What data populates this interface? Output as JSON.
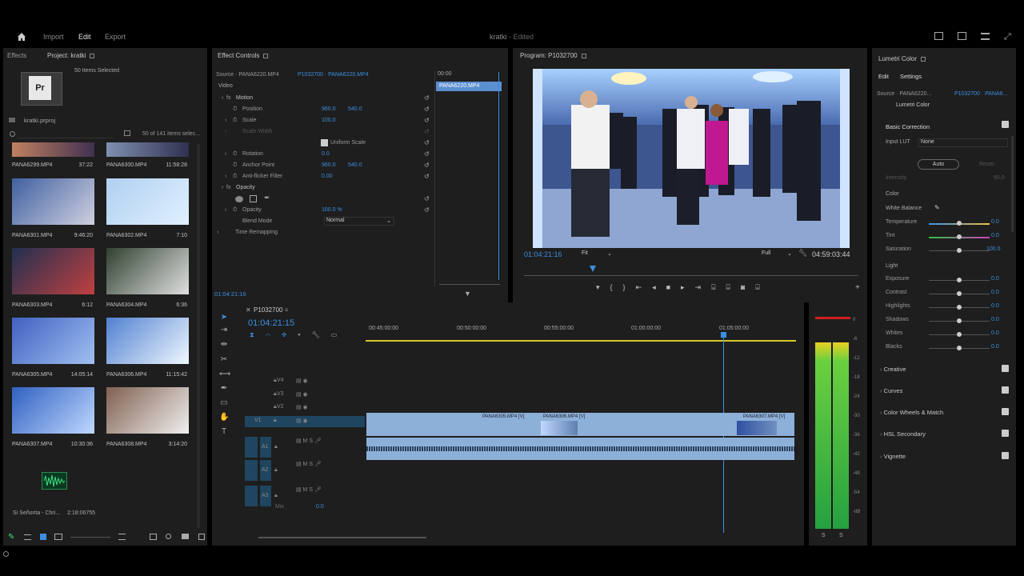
{
  "topbar": {
    "nav": [
      "Import",
      "Edit",
      "Export"
    ],
    "active": "Edit",
    "title": "kratki",
    "edited": "- Edited"
  },
  "project": {
    "tabs": [
      "Effects",
      "Project: kratki"
    ],
    "selected_count": "50 Items Selected",
    "file": "kratki.prproj",
    "items_info": "50 of 141 items selec...",
    "top_clips": [
      {
        "name": "PANA6299.MP4",
        "dur": "37:22"
      },
      {
        "name": "PANA6300.MP4",
        "dur": "11:58:28"
      }
    ],
    "clips": [
      {
        "name": "PANA6301.MP4",
        "dur": "9:46:20"
      },
      {
        "name": "PANA6302.MP4",
        "dur": "7:10"
      },
      {
        "name": "PANA6303.MP4",
        "dur": "6:12"
      },
      {
        "name": "PANA6304.MP4",
        "dur": "6:36"
      },
      {
        "name": "PANA6305.MP4",
        "dur": "14:05:14"
      },
      {
        "name": "PANA6306.MP4",
        "dur": "11:15:42"
      },
      {
        "name": "PANA6307.MP4",
        "dur": "10:30:36"
      },
      {
        "name": "PANA6308.MP4",
        "dur": "3:14:20"
      }
    ],
    "audio_name": "Si Señorita - Chri...",
    "audio_dur": "2:18:06755"
  },
  "effect_controls": {
    "title": "Effect Controls",
    "source": "Source · PANA6220.MP4",
    "sequence": "P1032700 · PANA6220.MP4",
    "time": "00:00",
    "clip": "PANA6220.MP4",
    "video": "Video",
    "motion": "Motion",
    "position": "Position",
    "pos_x": "960.0",
    "pos_y": "540.0",
    "scale": "Scale",
    "scale_v": "100.0",
    "scale_width": "Scale Width",
    "uniform": "Uniform Scale",
    "rotation": "Rotation",
    "rot_v": "0.0",
    "anchor": "Anchor Point",
    "anc_x": "960.0",
    "anc_y": "540.0",
    "flicker": "Anti-flicker Filter",
    "flick_v": "0.00",
    "opacity_grp": "Opacity",
    "opacity": "Opacity",
    "opacity_v": "100.0 %",
    "blend": "Blend Mode",
    "blend_v": "Normal",
    "remap": "Time Remapping",
    "timecode": "01:04:21:16"
  },
  "program": {
    "title": "Program: P1032700",
    "tc": "01:04:21:16",
    "fit": "Fit",
    "full": "Full",
    "duration": "04:59:03:44"
  },
  "timeline": {
    "seq": "P1032700",
    "tc": "01:04:21:15",
    "ruler": [
      "00:45:00:00",
      "00:50:00:00",
      "00:55:00:00",
      "01:00:00:00",
      "01:05:00:00"
    ],
    "video_tracks": [
      "V4",
      "V3",
      "V2",
      "V1"
    ],
    "audio_tracks": [
      "A1",
      "A2",
      "A3"
    ],
    "mix": "Mix",
    "mix_v": "0.0",
    "clips": [
      "PANA6305.MP4 [V]",
      "PANA6306.MP4 [V]",
      "PANA6307.MP4 [V]"
    ]
  },
  "meter": {
    "labels": [
      "0",
      "-6",
      "-12",
      "-18",
      "-24",
      "-30",
      "-36",
      "-42",
      "-48",
      "-54",
      "-dB"
    ],
    "ch": [
      "S",
      "S"
    ]
  },
  "lumetri": {
    "title": "Lumetri Color",
    "tabs": [
      "Edit",
      "Settings"
    ],
    "source": "Source · PANA6220...",
    "seq": "P1032700 · PANA6...",
    "effect": "Lumetri Color",
    "basic": "Basic Correction",
    "lut_label": "Input LUT",
    "lut_v": "None",
    "auto": "Auto",
    "reset": "Reset",
    "intensity": "Intensity",
    "intensity_v": "50.0",
    "color": "Color",
    "wb": "White Balance",
    "color_rows": [
      {
        "l": "Temperature",
        "v": "0.0"
      },
      {
        "l": "Tint",
        "v": "0.0"
      },
      {
        "l": "Saturation",
        "v": "100.0"
      }
    ],
    "light": "Light",
    "light_rows": [
      {
        "l": "Exposure",
        "v": "0.0"
      },
      {
        "l": "Contrast",
        "v": "0.0"
      },
      {
        "l": "Highlights",
        "v": "0.0"
      },
      {
        "l": "Shadows",
        "v": "0.0"
      },
      {
        "l": "Whites",
        "v": "0.0"
      },
      {
        "l": "Blacks",
        "v": "0.0"
      }
    ],
    "sections": [
      "Creative",
      "Curves",
      "Color Wheels & Match",
      "HSL Secondary",
      "Vignette"
    ]
  }
}
